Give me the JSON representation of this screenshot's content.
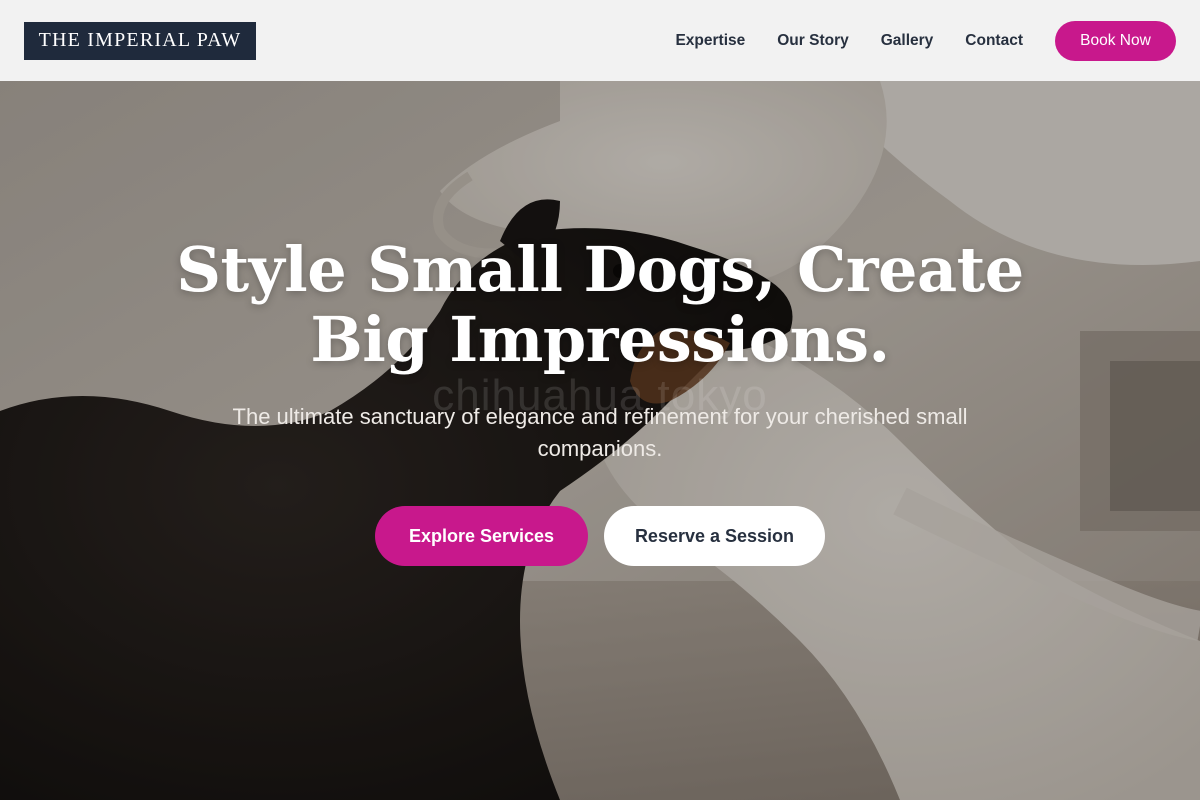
{
  "header": {
    "logo_text": "THE IMPERIAL PAW",
    "nav_items": [
      "Expertise",
      "Our Story",
      "Gallery",
      "Contact"
    ],
    "book_button_label": "Book Now"
  },
  "hero": {
    "title": "Style Small Dogs, Create Big Impressions.",
    "subtitle": "The ultimate sanctuary of elegance and refinement for your cherished small companions.",
    "primary_button_label": "Explore Services",
    "secondary_button_label": "Reserve a Session",
    "image_watermark": "chihuahua tokyo"
  },
  "colors": {
    "accent": "#c8188c",
    "logo_background": "#1f2a3c",
    "header_background": "#f2f2f2",
    "nav_text": "#27303f"
  }
}
